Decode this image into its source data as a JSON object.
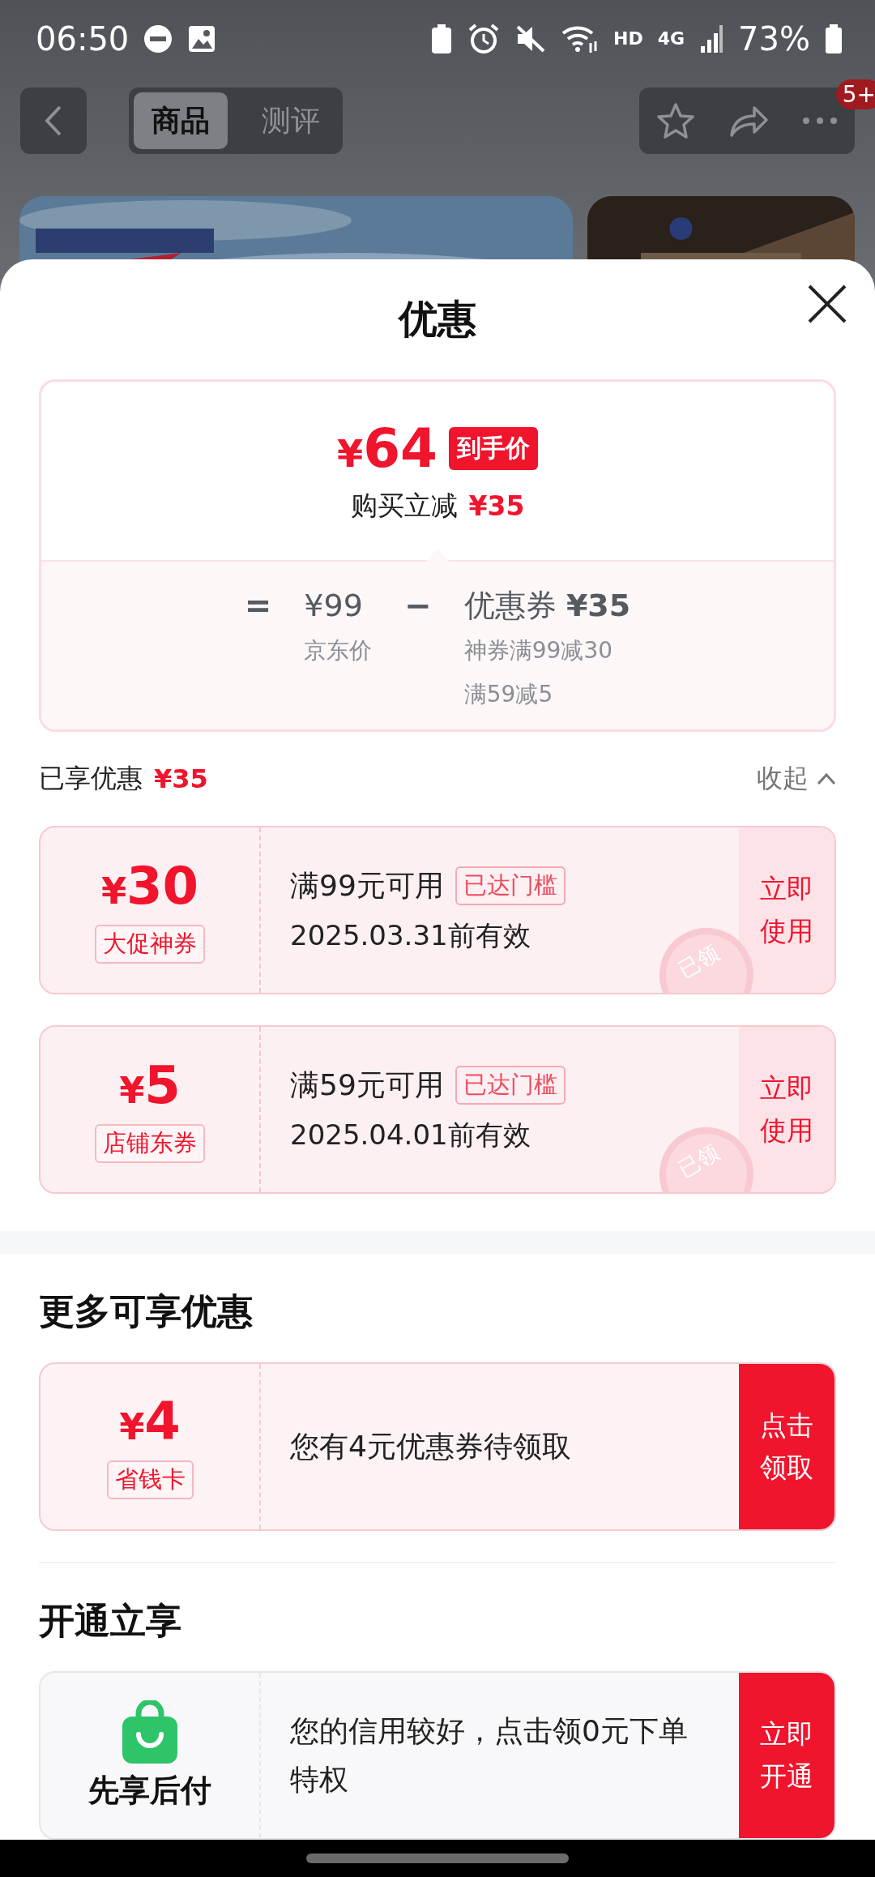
{
  "status_bar": {
    "time": "06:50",
    "network": "4G",
    "hd": "HD",
    "battery": "73%"
  },
  "top_bar": {
    "tabs": [
      {
        "label": "商品",
        "selected": true
      },
      {
        "label": "测评",
        "selected": false
      }
    ],
    "badge": "5+"
  },
  "sheet": {
    "title": "优惠",
    "summary": {
      "currency": "¥",
      "price": "64",
      "price_tag": "到手价",
      "saving_label": "购买立减",
      "saving": "¥35",
      "equals": "=",
      "list_price": "¥99",
      "list_price_label": "京东价",
      "minus": "−",
      "coupon_label": "优惠券",
      "coupon_total": "¥35",
      "coupon_details": [
        "神券满99减30",
        "满59减5"
      ]
    },
    "enjoyed": {
      "label": "已享优惠",
      "amount": "¥35",
      "toggle": "收起",
      "expanded": true
    },
    "coupons": [
      {
        "currency": "¥",
        "amount": "30",
        "tag": "大促神券",
        "condition": "满99元可用",
        "threshold": "已达门槛",
        "validity": "2025.03.31前有效",
        "action": "立即使用",
        "stamp": "已领"
      },
      {
        "currency": "¥",
        "amount": "5",
        "tag": "店铺东券",
        "condition": "满59元可用",
        "threshold": "已达门槛",
        "validity": "2025.04.01前有效",
        "action": "立即使用",
        "stamp": "已领"
      }
    ]
  },
  "more_offers": {
    "title": "更多可享优惠",
    "offers": [
      {
        "kind": "coupon",
        "currency": "¥",
        "amount": "4",
        "tag": "省钱卡",
        "text": "您有4元优惠券待领取",
        "action": "点击领取"
      }
    ]
  },
  "open_offers": {
    "title": "开通立享",
    "offers": [
      {
        "kind": "service",
        "name": "先享后付",
        "text": "您的信用较好，点击领0元下单特权",
        "action": "立即开通"
      }
    ]
  }
}
